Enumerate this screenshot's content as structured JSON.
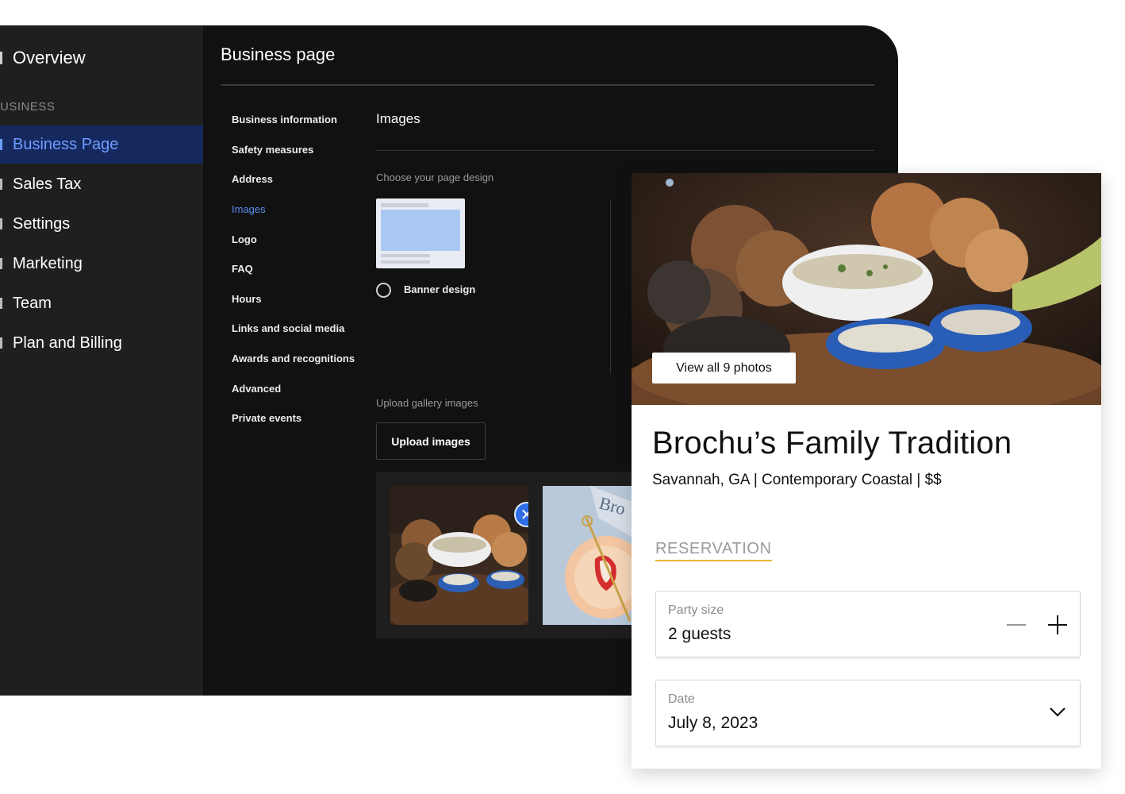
{
  "sidebar": {
    "overview": "Overview",
    "section": "USINESS",
    "items": [
      {
        "label": "Business Page",
        "active": true
      },
      {
        "label": "Sales Tax"
      },
      {
        "label": "Settings"
      },
      {
        "label": "Marketing"
      },
      {
        "label": "Team"
      },
      {
        "label": "Plan and Billing"
      }
    ]
  },
  "page": {
    "title": "Business page"
  },
  "subnav": [
    {
      "label": "Business information"
    },
    {
      "label": "Safety measures"
    },
    {
      "label": "Address"
    },
    {
      "label": "Images",
      "active": true
    },
    {
      "label": "Logo"
    },
    {
      "label": "FAQ"
    },
    {
      "label": "Hours"
    },
    {
      "label": "Links and social media"
    },
    {
      "label": "Awards and recognitions"
    },
    {
      "label": "Advanced"
    },
    {
      "label": "Private events"
    }
  ],
  "images": {
    "title": "Images",
    "choose_label": "Choose your page design",
    "design_option": "Banner design",
    "upload_label": "Upload gallery images",
    "upload_button": "Upload images"
  },
  "preview": {
    "view_photos": "View all 9 photos",
    "name": "Brochu’s Family Tradition",
    "meta": "Savannah, GA | Contemporary Coastal | $$",
    "tab": "RESERVATION",
    "party_label": "Party size",
    "party_value": "2 guests",
    "date_label": "Date",
    "date_value": "July 8, 2023"
  },
  "colors": {
    "accent_blue": "#5b8def",
    "active_bg": "#15295f",
    "tab_underline": "#e7b33a"
  }
}
